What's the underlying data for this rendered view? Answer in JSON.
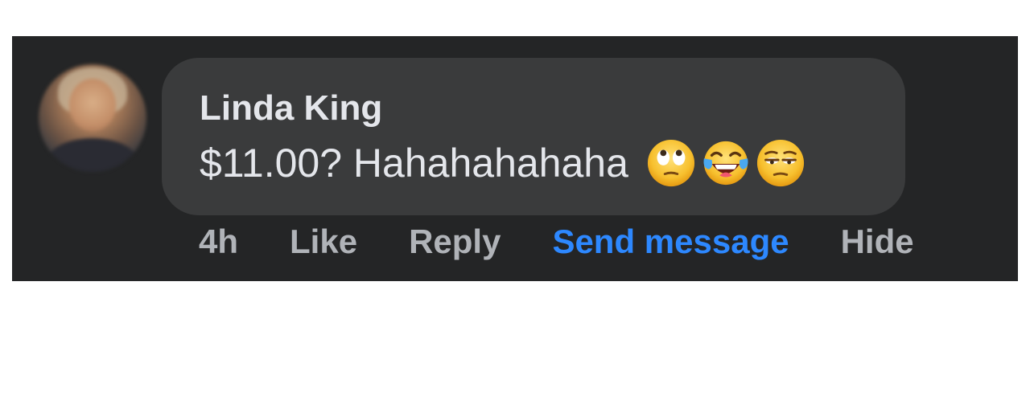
{
  "comment": {
    "author": "Linda King",
    "text": "$11.00? Hahahahahaha",
    "emojis": [
      "face-with-rolling-eyes",
      "face-with-tears-of-joy",
      "relieved-unamused-face"
    ]
  },
  "actions": {
    "time": "4h",
    "like": "Like",
    "reply": "Reply",
    "send_message": "Send message",
    "hide": "Hide"
  },
  "colors": {
    "panel_bg": "#242526",
    "bubble_bg": "#3a3b3c",
    "primary_text": "#e4e6eb",
    "secondary_text": "#b0b3b8",
    "link_blue": "#2d88ff"
  }
}
